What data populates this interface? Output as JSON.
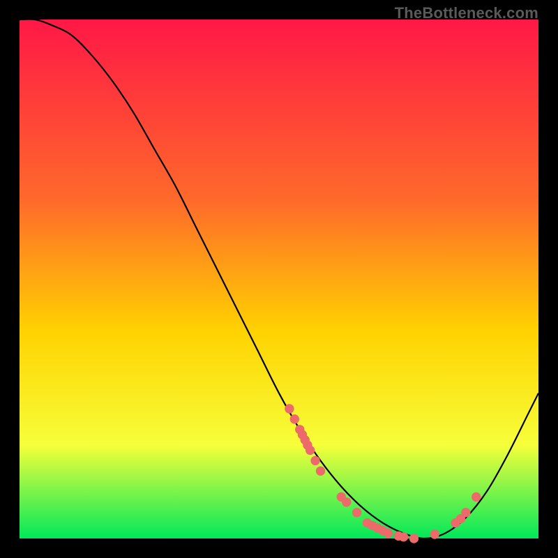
{
  "watermark": "TheBottleneck.com",
  "colors": {
    "gradient_top": "#ff1846",
    "gradient_mid1": "#ff6a2a",
    "gradient_mid2": "#ffd200",
    "gradient_mid3": "#f6ff3a",
    "gradient_bottom": "#00e85a",
    "curve": "#000000",
    "marker": "#ec6a6a",
    "background": "#000000"
  },
  "chart_data": {
    "type": "line",
    "title": "",
    "xlabel": "",
    "ylabel": "",
    "xlim": [
      0,
      100
    ],
    "ylim": [
      0,
      100
    ],
    "series": [
      {
        "name": "bottleneck-curve",
        "x": [
          0,
          3,
          6,
          10,
          14,
          18,
          22,
          26,
          30,
          34,
          38,
          42,
          46,
          50,
          54,
          58,
          62,
          66,
          70,
          74,
          78,
          82,
          86,
          90,
          94,
          98,
          100
        ],
        "values": [
          100,
          100,
          99,
          97,
          93,
          88,
          82,
          75,
          68,
          60,
          52,
          44,
          36,
          28,
          21,
          15,
          10,
          6,
          3,
          1,
          0,
          1,
          4,
          9,
          16,
          24,
          28
        ]
      }
    ],
    "markers": {
      "name": "sample-points",
      "x": [
        52,
        53,
        54,
        54.5,
        55,
        55.5,
        56,
        57,
        58,
        62,
        63,
        65,
        67,
        68,
        69,
        70,
        71,
        73,
        74,
        76,
        80,
        84,
        85,
        86,
        88
      ],
      "values": [
        25,
        23,
        21,
        20,
        19,
        18,
        17,
        15,
        13,
        8,
        7,
        5,
        3,
        2.5,
        2,
        1.5,
        1,
        0.5,
        0.3,
        0,
        0.8,
        3,
        3.8,
        5,
        8
      ]
    }
  }
}
